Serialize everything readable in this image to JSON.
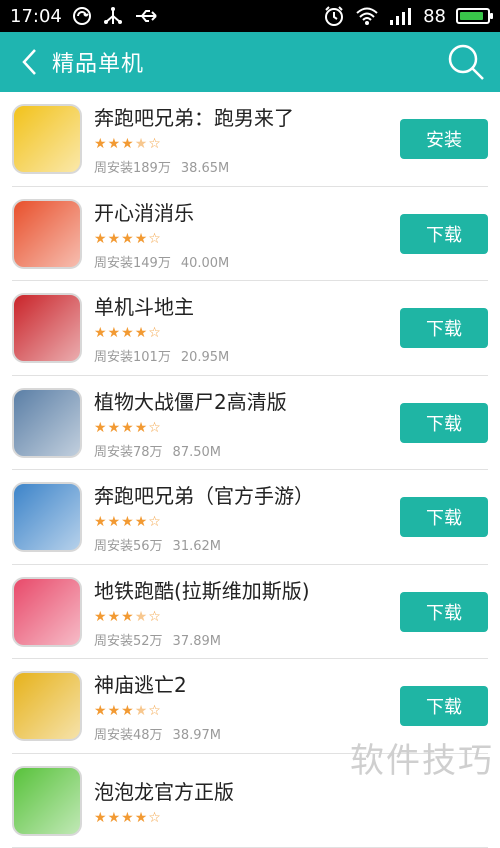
{
  "status_bar": {
    "time": "17:04",
    "battery_level": "88",
    "battery_fill": 0.88,
    "icons": [
      "sync-icon",
      "usb-icon",
      "usb-connected-icon",
      "alarm-icon",
      "wifi-icon",
      "signal-icon",
      "battery-icon"
    ]
  },
  "header": {
    "title": "精品单机",
    "back_icon": "chevron-left-icon",
    "search_icon": "search-icon",
    "background": "#1fb5b0"
  },
  "apps": [
    {
      "name": "奔跑吧兄弟：跑男来了",
      "rating": 3.5,
      "weekly_installs": "周安装189万",
      "size": "38.65M",
      "action": "安装",
      "icon_color": "#f2c21b"
    },
    {
      "name": "开心消消乐",
      "rating": 4,
      "weekly_installs": "周安装149万",
      "size": "40.00M",
      "action": "下载",
      "icon_color": "#e8502c"
    },
    {
      "name": "单机斗地主",
      "rating": 4,
      "weekly_installs": "周安装101万",
      "size": "20.95M",
      "action": "下载",
      "icon_color": "#c9242a"
    },
    {
      "name": "植物大战僵尸2高清版",
      "rating": 4,
      "weekly_installs": "周安装78万",
      "size": "87.50M",
      "action": "下载",
      "icon_color": "#5b7fa6"
    },
    {
      "name": "奔跑吧兄弟（官方手游）",
      "rating": 4,
      "weekly_installs": "周安装56万",
      "size": "31.62M",
      "action": "下载",
      "icon_color": "#3d84c9"
    },
    {
      "name": "地铁跑酷(拉斯维加斯版)",
      "rating": 3.5,
      "weekly_installs": "周安装52万",
      "size": "37.89M",
      "action": "下载",
      "icon_color": "#e84a6a"
    },
    {
      "name": "神庙逃亡2",
      "rating": 3.5,
      "weekly_installs": "周安装48万",
      "size": "38.97M",
      "action": "下载",
      "icon_color": "#e6b21c"
    },
    {
      "name": "泡泡龙官方正版",
      "rating": 4,
      "weekly_installs": "",
      "size": "",
      "action": "",
      "icon_color": "#58c23b"
    }
  ],
  "accent_color": "#1fb5a4",
  "star_color": "#f29a33",
  "watermark": "软件技巧"
}
